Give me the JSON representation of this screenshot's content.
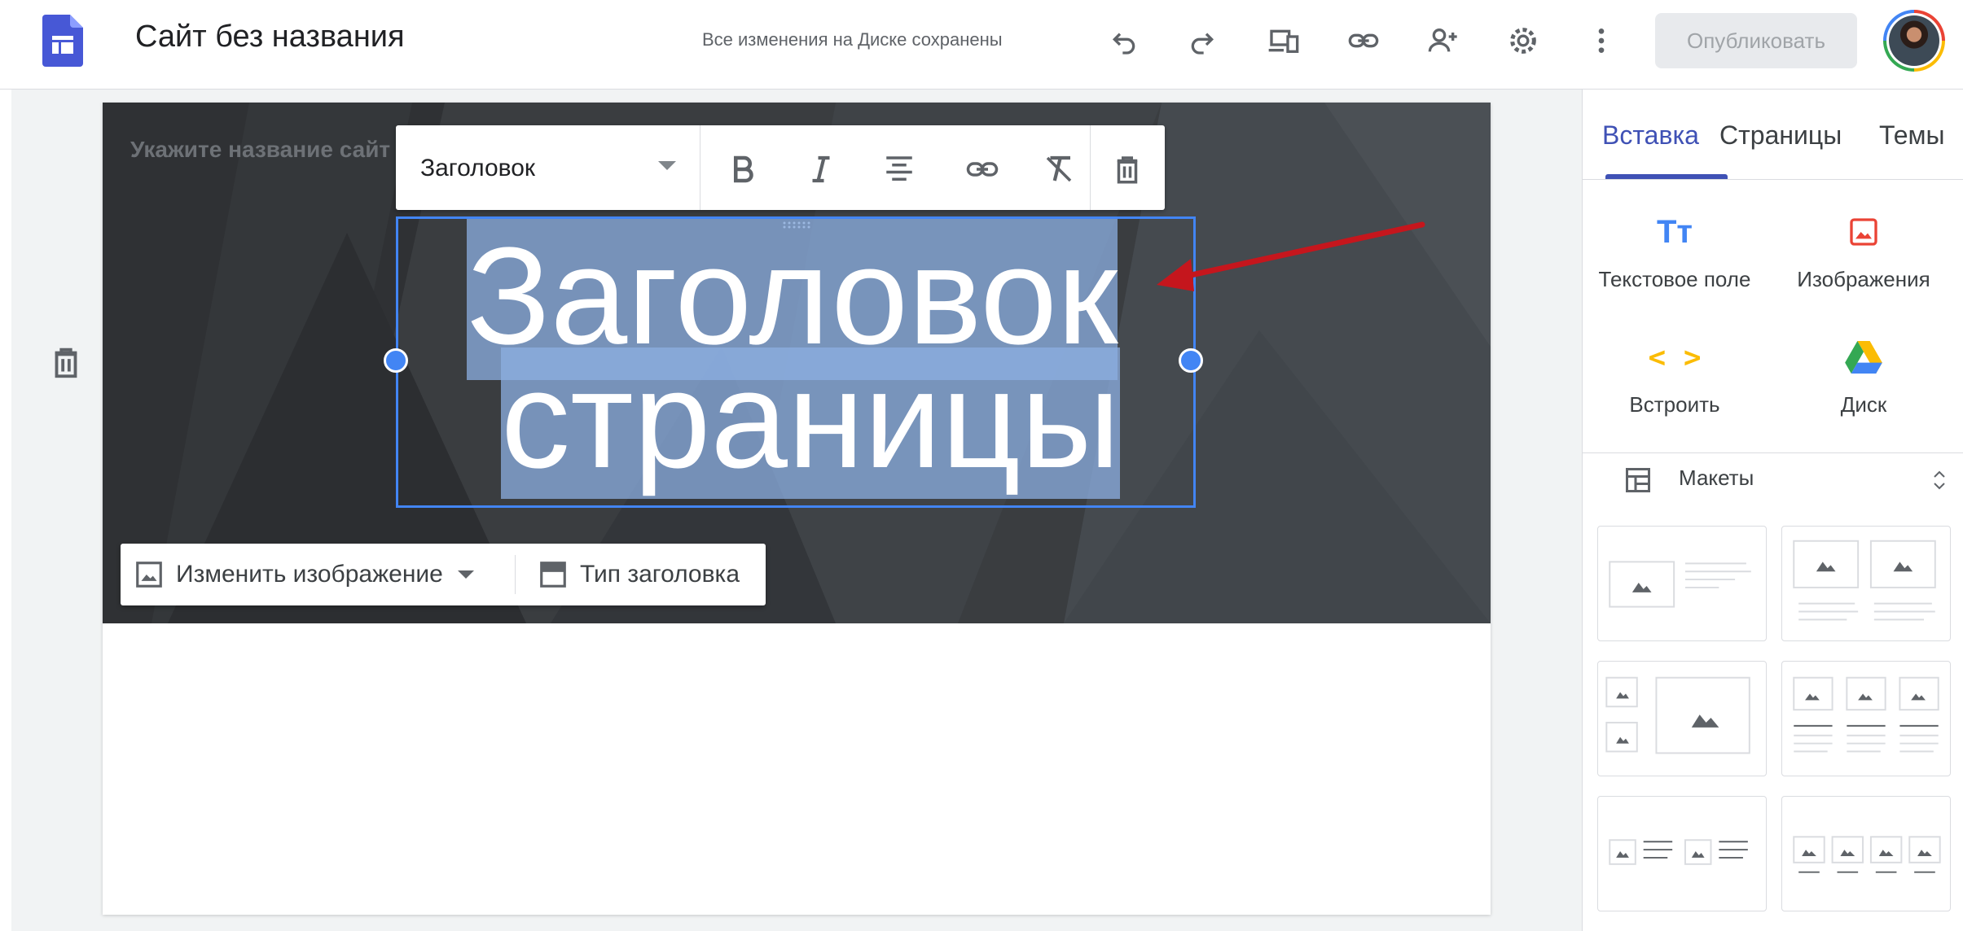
{
  "header": {
    "site_title": "Сайт без названия",
    "save_status": "Все изменения на Диске сохранены",
    "publish_label": "Опубликовать",
    "toolbar_icons": [
      "undo-icon",
      "redo-icon",
      "preview-icon",
      "link-icon",
      "share-icon",
      "settings-icon",
      "more-vert-icon"
    ]
  },
  "editor": {
    "site_name_placeholder": "Укажите название сайт",
    "title_line1": "Заголовок",
    "title_line2": "страницы",
    "format_toolbar": {
      "style_label": "Заголовок",
      "buttons": [
        "bold-icon",
        "italic-icon",
        "align-center-icon",
        "link-icon",
        "clear-format-icon",
        "delete-icon"
      ]
    },
    "header_toolbar": {
      "change_image_label": "Изменить изображение",
      "header_type_label": "Тип заголовка"
    },
    "colors": {
      "selection": "#8cafe1",
      "handle": "#4285f4",
      "annotation_arrow": "#c5161d",
      "banner": "#37393c"
    }
  },
  "right_panel": {
    "tabs": [
      "Вставка",
      "Страницы",
      "Темы"
    ],
    "active_tab": "Вставка",
    "insert_items": {
      "text_box": "Текстовое поле",
      "images": "Изображения",
      "embed": "Встроить",
      "drive": "Диск"
    },
    "text_box_glyph": "Tт",
    "embed_glyph": "< >",
    "layouts_label": "Макеты",
    "accent_color": "#3f51b5"
  }
}
